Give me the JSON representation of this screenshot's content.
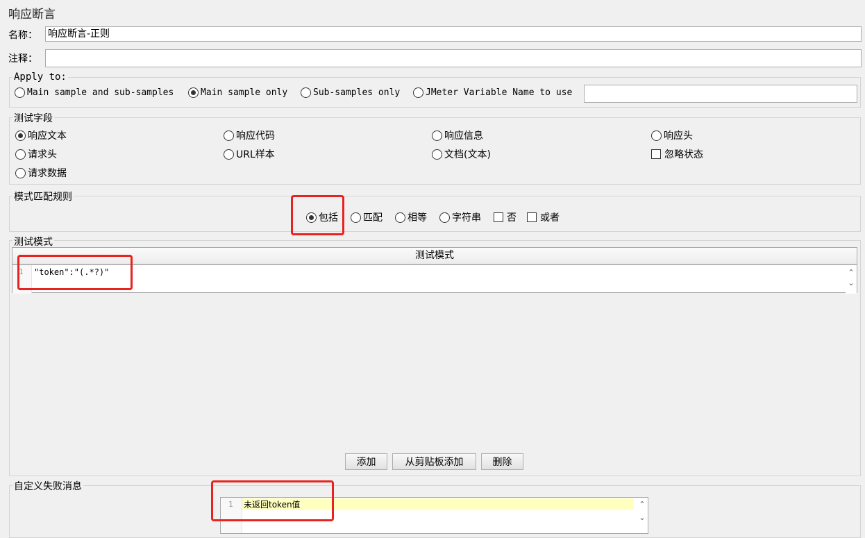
{
  "header": {
    "title": "响应断言"
  },
  "form": {
    "name_label": "名称：",
    "name_value": "响应断言-正则",
    "comment_label": "注释：",
    "comment_value": ""
  },
  "apply_to": {
    "title": "Apply to:",
    "options": [
      {
        "label": "Main sample and sub-samples",
        "selected": false
      },
      {
        "label": "Main sample only",
        "selected": true
      },
      {
        "label": "Sub-samples only",
        "selected": false
      },
      {
        "label": "JMeter Variable Name to use",
        "selected": false
      }
    ],
    "variable_value": ""
  },
  "test_field": {
    "title": "测试字段",
    "options": [
      {
        "label": "响应文本",
        "selected": true
      },
      {
        "label": "响应代码",
        "selected": false
      },
      {
        "label": "响应信息",
        "selected": false
      },
      {
        "label": "响应头",
        "selected": false
      },
      {
        "label": "请求头",
        "selected": false
      },
      {
        "label": "URL样本",
        "selected": false
      },
      {
        "label": "文档(文本)",
        "selected": false
      },
      {
        "label": "请求数据",
        "selected": false
      }
    ],
    "ignore_status": {
      "label": "忽略状态",
      "checked": false
    }
  },
  "match_rules": {
    "title": "模式匹配规则",
    "options": [
      {
        "label": "包括",
        "selected": true
      },
      {
        "label": "匹配",
        "selected": false
      },
      {
        "label": "相等",
        "selected": false
      },
      {
        "label": "字符串",
        "selected": false
      }
    ],
    "not": {
      "label": "否",
      "checked": false
    },
    "or": {
      "label": "或者",
      "checked": false
    }
  },
  "patterns": {
    "title": "测试模式",
    "column_header": "测试模式",
    "rows": [
      {
        "line": "1",
        "text": "\"token\":\"(.*?)\""
      }
    ],
    "buttons": {
      "add": "添加",
      "add_clipboard": "从剪贴板添加",
      "delete": "删除"
    }
  },
  "failure_message": {
    "title": "自定义失败消息",
    "line": "1",
    "text": "未返回token值"
  },
  "icons": {
    "scroll_up": "chevron-up-icon",
    "scroll_down": "chevron-down-icon"
  },
  "colors": {
    "highlight_annotation": "#e8231f",
    "current_line": "#ffffc0"
  }
}
